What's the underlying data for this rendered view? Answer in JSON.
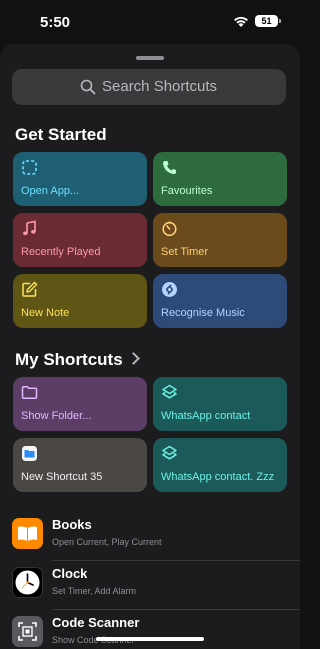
{
  "status_bar": {
    "time": "5:50",
    "battery": "51"
  },
  "search": {
    "placeholder": "Search Shortcuts"
  },
  "get_started": {
    "title": "Get Started",
    "tiles": [
      {
        "label": "Open App...",
        "color": "#1f5f74",
        "text_color": "#6ee0ff",
        "icon": "dashed-square-icon"
      },
      {
        "label": "Favourites",
        "color": "#2e6b3f",
        "text_color": "#b9ffcb",
        "icon": "phone-icon"
      },
      {
        "label": "Recently Played",
        "color": "#6b2b33",
        "text_color": "#ff9aa8",
        "icon": "music-note-icon"
      },
      {
        "label": "Set Timer",
        "color": "#6b4a1b",
        "text_color": "#ffd07a",
        "icon": "timer-icon"
      },
      {
        "label": "New Note",
        "color": "#5f5515",
        "text_color": "#ffe45a",
        "icon": "compose-icon"
      },
      {
        "label": "Recognise Music",
        "color": "#2d4a78",
        "text_color": "#b6d3ff",
        "icon": "shazam-icon"
      }
    ]
  },
  "my_shortcuts": {
    "title": "My Shortcuts",
    "tiles": [
      {
        "label": "Show Folder...",
        "color": "#5c3d66",
        "text_color": "#e3b7ff",
        "icon": "folder-icon"
      },
      {
        "label": "WhatsApp contact",
        "color": "#1b5a58",
        "text_color": "#6ff0e6",
        "icon": "shortcut-layers-icon"
      },
      {
        "label": "New Shortcut 35",
        "color": "#4a4745",
        "text_color": "#f0f0f0",
        "icon": "files-icon"
      },
      {
        "label": "WhatsApp contact. Zzz",
        "color": "#1b5a58",
        "text_color": "#6ff0e6",
        "icon": "shortcut-layers-icon"
      }
    ]
  },
  "apps": [
    {
      "name": "Books",
      "sub": "Open Current, Play Current",
      "icon": "books-icon"
    },
    {
      "name": "Clock",
      "sub": "Set Timer, Add Alarm",
      "icon": "clock-icon"
    },
    {
      "name": "Code Scanner",
      "sub": "Show Code Scanner",
      "icon": "code-scanner-icon"
    }
  ]
}
